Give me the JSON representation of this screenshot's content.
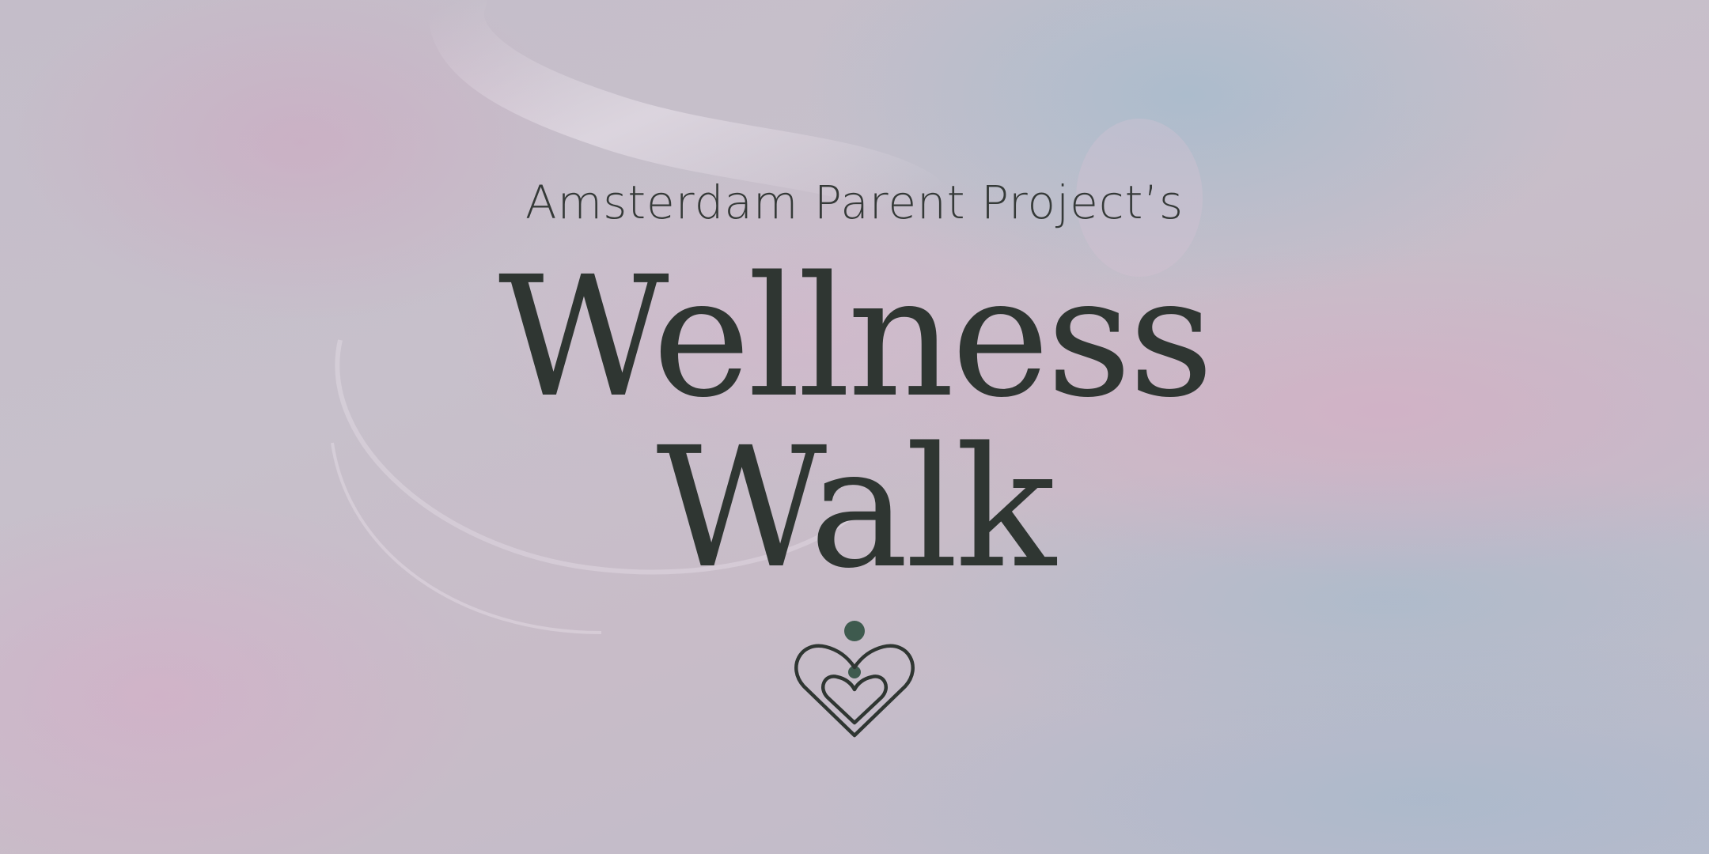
{
  "poster": {
    "subtitle": "Amsterdam Parent Project’s",
    "title_line1": "Wellness",
    "title_line2": "Walk",
    "logo_icon": "heart-family-icon"
  },
  "colors": {
    "text_dark": "#2f3632",
    "logo_green": "#3e5a4e",
    "bg_pink": "#d8a9c4",
    "bg_blue": "#96b9cd"
  }
}
